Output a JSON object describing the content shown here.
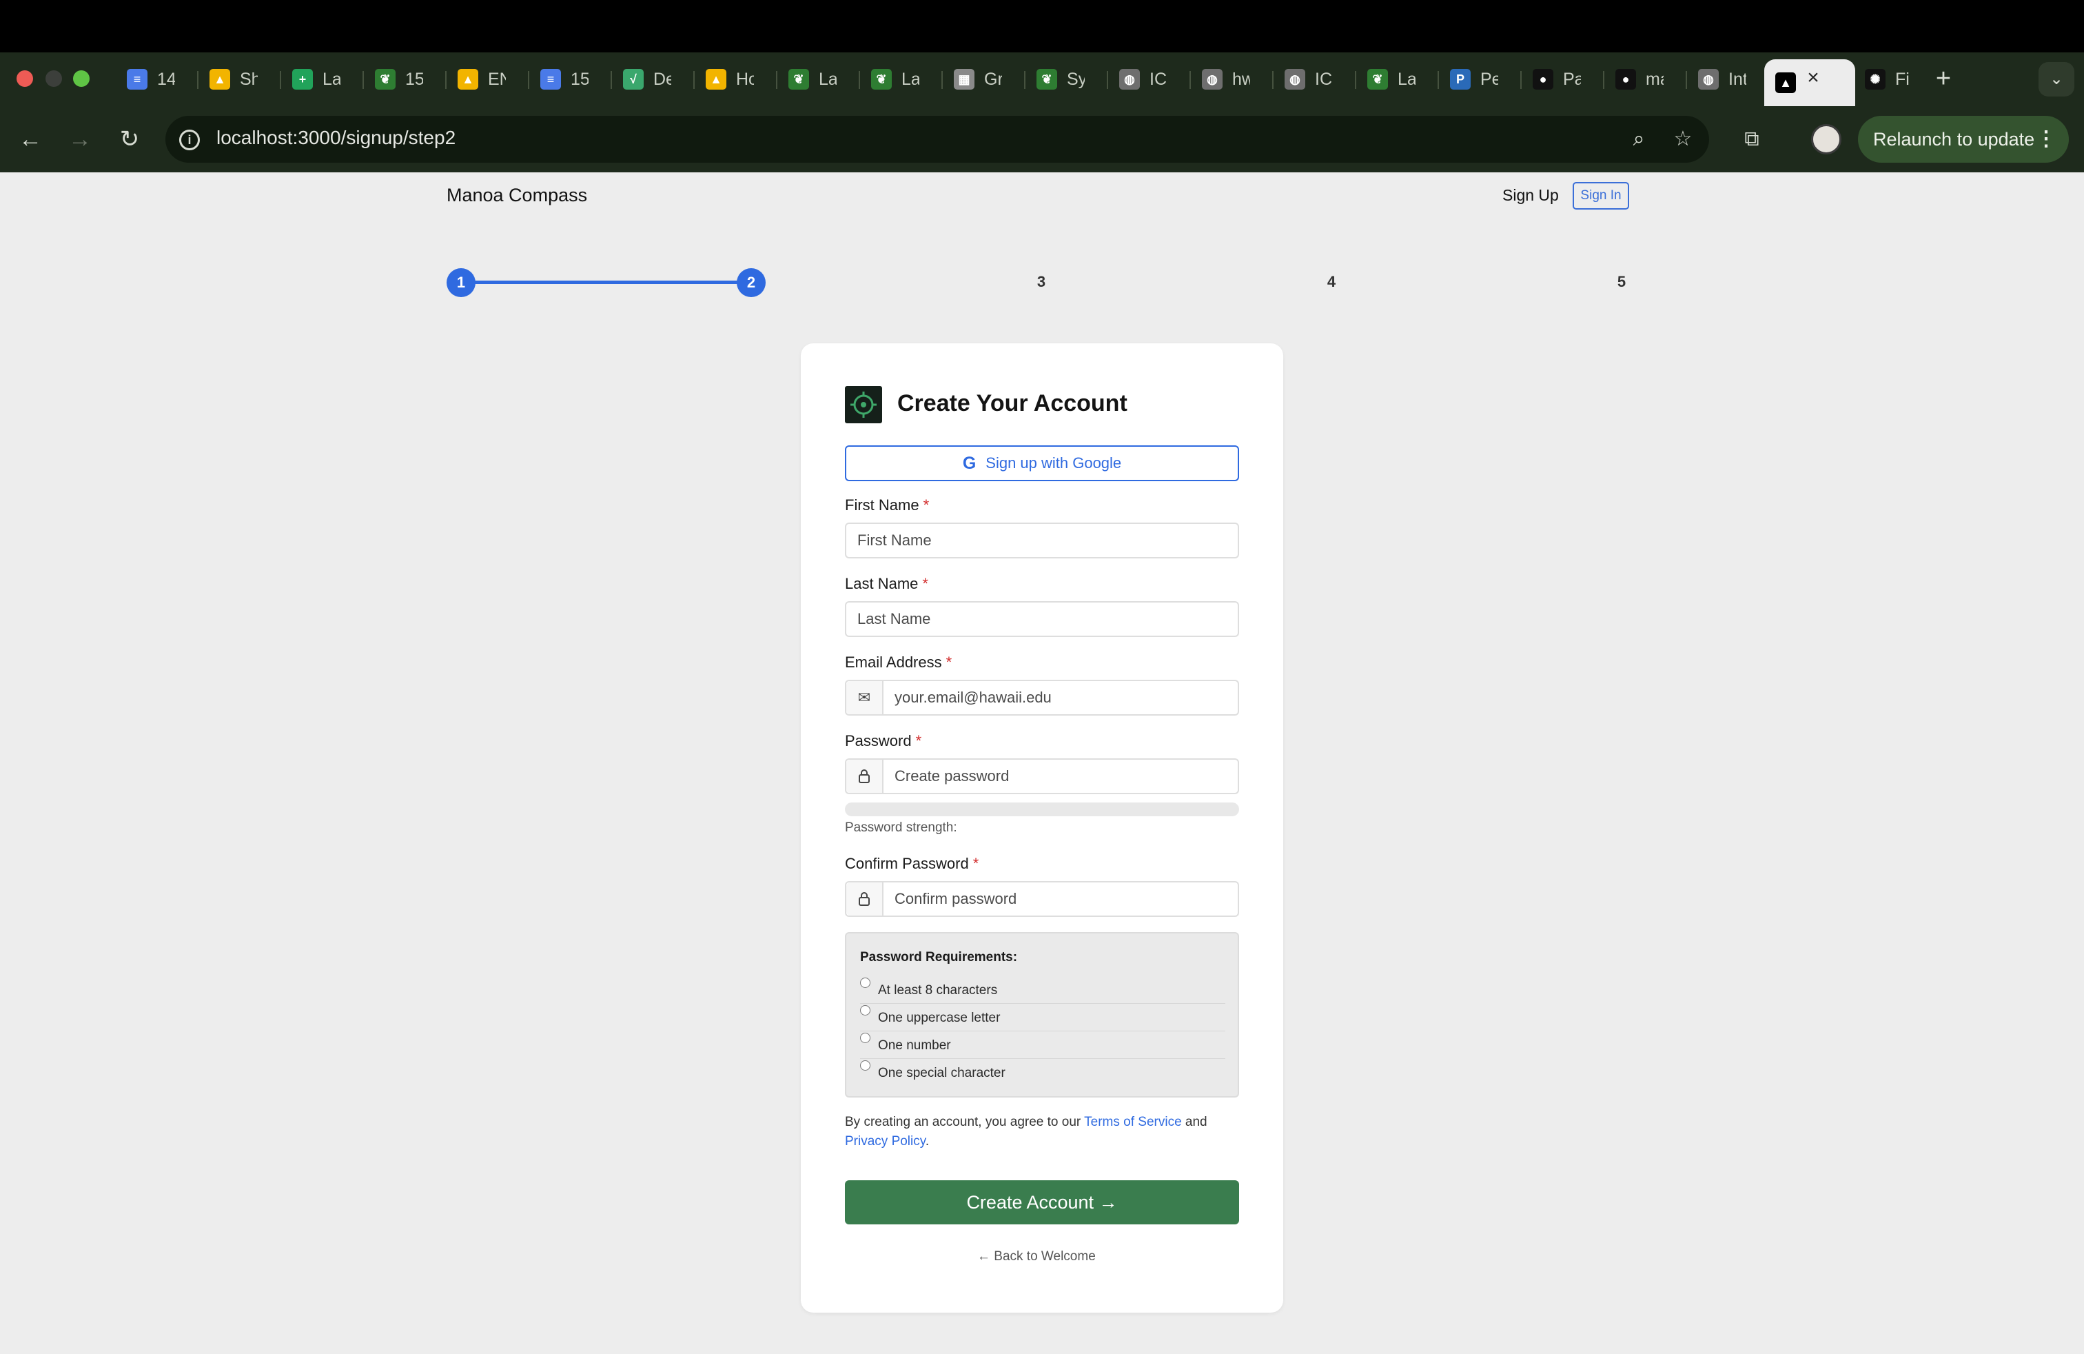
{
  "browser": {
    "tabs": [
      {
        "label": "14",
        "icon": "docs-icon",
        "color": "#4a7ae8"
      },
      {
        "label": "Sh",
        "icon": "drive-icon",
        "color": "#f2b400"
      },
      {
        "label": "La",
        "icon": "sheets-icon",
        "color": "#21a35a"
      },
      {
        "label": "15",
        "icon": "leaf-icon",
        "color": "#2e7d32"
      },
      {
        "label": "EN",
        "icon": "drive-icon",
        "color": "#f2b400"
      },
      {
        "label": "15",
        "icon": "docs-icon",
        "color": "#4a7ae8"
      },
      {
        "label": "De",
        "icon": "chart-icon",
        "color": "#3aa76d"
      },
      {
        "label": "Ho",
        "icon": "drive-icon",
        "color": "#f2b400"
      },
      {
        "label": "La",
        "icon": "leaf-icon",
        "color": "#2e7d32"
      },
      {
        "label": "La",
        "icon": "leaf-icon",
        "color": "#2e7d32"
      },
      {
        "label": "Gr",
        "icon": "calculator-icon",
        "color": "#8a8a8a"
      },
      {
        "label": "Sy",
        "icon": "leaf-icon",
        "color": "#2e7d32"
      },
      {
        "label": "IC",
        "icon": "globe-icon",
        "color": "#6e6e6e"
      },
      {
        "label": "hw",
        "icon": "globe-icon",
        "color": "#6e6e6e"
      },
      {
        "label": "IC",
        "icon": "globe-icon",
        "color": "#6e6e6e"
      },
      {
        "label": "La",
        "icon": "leaf-icon",
        "color": "#2e7d32"
      },
      {
        "label": "Pe",
        "icon": "pearson-icon",
        "color": "#2a6ab8"
      },
      {
        "label": "Pa",
        "icon": "github-icon",
        "color": "#111111"
      },
      {
        "label": "ma",
        "icon": "github-icon",
        "color": "#111111"
      },
      {
        "label": "Int",
        "icon": "globe-icon",
        "color": "#6e6e6e"
      },
      {
        "label": "",
        "icon": "triangle-icon",
        "color": "#000000"
      },
      {
        "label": "Fi",
        "icon": "openai-icon",
        "color": "#111111"
      }
    ],
    "url": "localhost:3000/signup/step2",
    "relaunch_label": "Relaunch to update"
  },
  "nav": {
    "brand": "Manoa Compass",
    "signup_label": "Sign Up",
    "signin_label": "Sign In"
  },
  "steps": {
    "items": [
      "1",
      "2",
      "3",
      "4",
      "5"
    ],
    "current": 2
  },
  "form": {
    "title": "Create Your Account",
    "google_label": "Sign up with Google",
    "first_name": {
      "label": "First Name",
      "placeholder": "First Name"
    },
    "last_name": {
      "label": "Last Name",
      "placeholder": "Last Name"
    },
    "email": {
      "label": "Email Address",
      "placeholder": "your.email@hawaii.edu"
    },
    "password": {
      "label": "Password",
      "placeholder": "Create password"
    },
    "strength_label": "Password strength:",
    "strength_value": 0,
    "confirm": {
      "label": "Confirm Password",
      "placeholder": "Confirm password"
    },
    "required_mark": "*",
    "requirements": {
      "title": "Password Requirements:",
      "items": [
        "At least 8 characters",
        "One uppercase letter",
        "One number",
        "One special character"
      ]
    },
    "terms": {
      "prefix": "By creating an account, you agree to our ",
      "tos": "Terms of Service",
      "and": " and",
      "privacy": "Privacy Policy",
      "suffix": "."
    },
    "submit_label": "Create Account →",
    "back_label": "← Back to Welcome"
  }
}
